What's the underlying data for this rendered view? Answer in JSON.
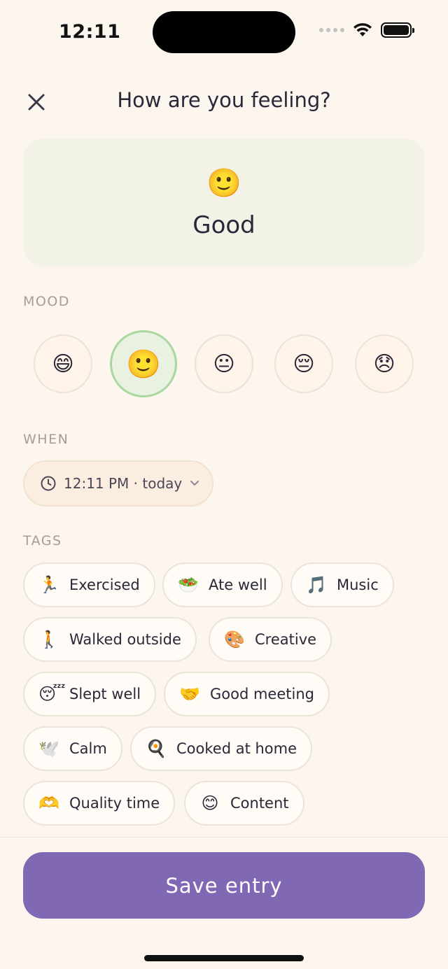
{
  "status_bar": {
    "time": "12:11"
  },
  "header": {
    "title": "How are you feeling?",
    "close_icon": "close-icon"
  },
  "hero": {
    "emoji": "🙂",
    "label": "Good"
  },
  "mood": {
    "section_label": "MOOD",
    "options": [
      {
        "emoji": "😄",
        "selected": false
      },
      {
        "emoji": "🙂",
        "selected": true
      },
      {
        "emoji": "😐",
        "selected": false
      },
      {
        "emoji": "😔",
        "selected": false
      },
      {
        "emoji": "😞",
        "selected": false
      }
    ]
  },
  "when": {
    "section_label": "WHEN",
    "value": "12:11 PM · today",
    "icon": "clock-icon",
    "chevron": "chevron-down-icon"
  },
  "tags": {
    "section_label": "TAGS",
    "items": [
      {
        "emoji": "🏃",
        "label": "Exercised"
      },
      {
        "emoji": "🥗",
        "label": "Ate well"
      },
      {
        "emoji": "🎵",
        "label": "Music"
      },
      {
        "emoji": "🚶",
        "label": "Walked outside"
      },
      {
        "emoji": "🎨",
        "label": "Creative"
      },
      {
        "emoji": "😴",
        "label": "Slept well"
      },
      {
        "emoji": "🤝",
        "label": "Good meeting"
      },
      {
        "emoji": "🕊️",
        "label": "Calm"
      },
      {
        "emoji": "🍳",
        "label": "Cooked at home"
      },
      {
        "emoji": "🫶",
        "label": "Quality time"
      },
      {
        "emoji": "😊",
        "label": "Content"
      }
    ]
  },
  "footer": {
    "save_label": "Save entry"
  },
  "colors": {
    "background": "#fdf6ee",
    "accent": "#8168b5",
    "selected_mood_border": "#a8d7a2",
    "hero_bg": "#f3f2e6"
  }
}
